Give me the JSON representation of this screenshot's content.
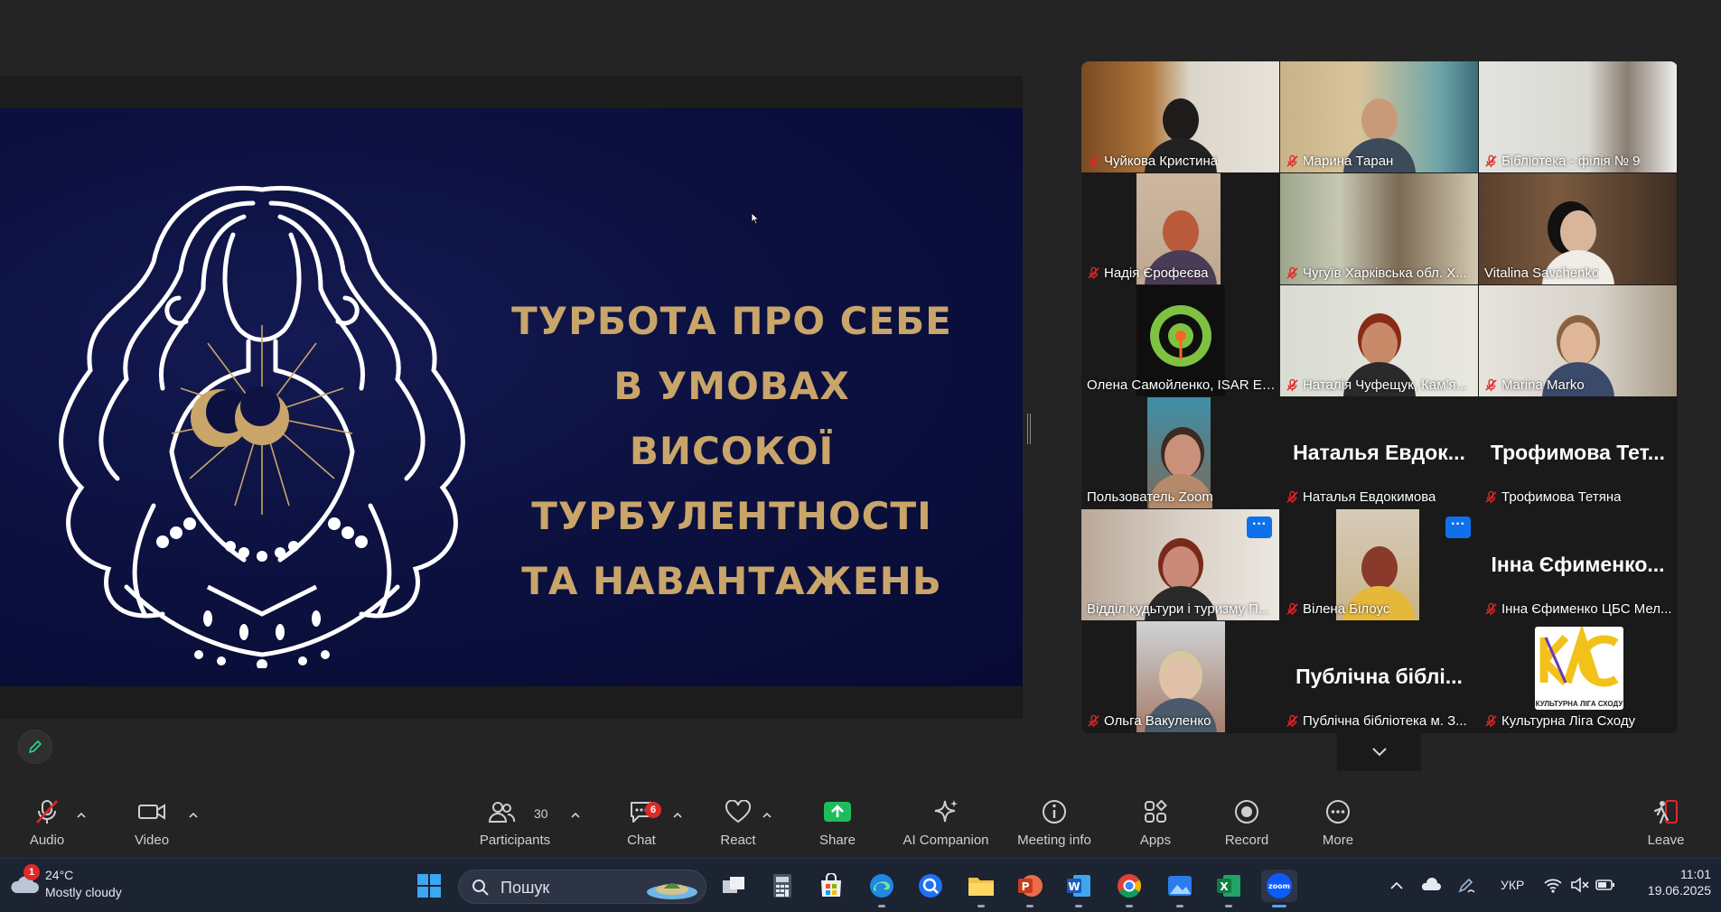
{
  "slide": {
    "title_lines": [
      "ТУРБОТА ПРО СЕБЕ",
      "В УМОВАХ ВИСОКОЇ",
      "ТУРБУЛЕНТНОСТІ",
      "ТА НАВАНТАЖЕНЬ"
    ],
    "title_color": "#c9a56a",
    "background_color": "#0c1140"
  },
  "gallery": {
    "active_speaker_color": "#2ad68a",
    "tiles": [
      {
        "name": "Чуйкова Кристина",
        "muted": true
      },
      {
        "name": "Марина Таран",
        "muted": true
      },
      {
        "name": "Бібліотека - філія № 9",
        "muted": true
      },
      {
        "name": "Надія Єрофеєва",
        "muted": true
      },
      {
        "name": "Чугуїв Харківська обл. Х...",
        "muted": true
      },
      {
        "name": "Vitalina Savchenko",
        "muted": false
      },
      {
        "name": "Олена Самойленко, ISAR Ed...",
        "muted": false
      },
      {
        "name": "Наталія Чуфещук, Кам'я...",
        "muted": true
      },
      {
        "name": "Marina Marko",
        "muted": true
      },
      {
        "name": "Пользователь Zoom",
        "muted": false
      },
      {
        "name": "Наталья Евдокимова",
        "big_name": "Наталья Евдок...",
        "muted": true
      },
      {
        "name": "Трофимова Тетяна",
        "big_name": "Трофимова Тет...",
        "muted": true
      },
      {
        "name": "Відділ кудьтури і туризму П...",
        "muted": false
      },
      {
        "name": "Вілена Білоус",
        "muted": true
      },
      {
        "name": "Інна Єфименко ЦБС Мел...",
        "big_name": "Інна Єфименко...",
        "muted": true
      },
      {
        "name": "Ольга Вакуленко",
        "muted": true
      },
      {
        "name": "Публічна бібліотека м. З...",
        "big_name": "Публічна біблі...",
        "muted": true
      },
      {
        "name": "Культурна Ліга Сходу",
        "muted": true
      }
    ],
    "logo_text": "КУЛЬТУРНА ЛІГА СХОДУ"
  },
  "toolbar": {
    "audio": "Audio",
    "video": "Video",
    "participants": "Participants",
    "participants_count": "30",
    "chat": "Chat",
    "chat_badge": "6",
    "react": "React",
    "share": "Share",
    "ai_companion": "AI Companion",
    "meeting_info": "Meeting info",
    "apps": "Apps",
    "record": "Record",
    "more": "More",
    "leave": "Leave",
    "share_color": "#1dbd5b",
    "leave_color": "#e02828"
  },
  "taskbar": {
    "weather_temp": "24°C",
    "weather_desc": "Mostly cloudy",
    "weather_badge": "1",
    "search_placeholder": "Пошук",
    "language": "УКР",
    "time": "11:01",
    "date": "19.06.2025"
  }
}
